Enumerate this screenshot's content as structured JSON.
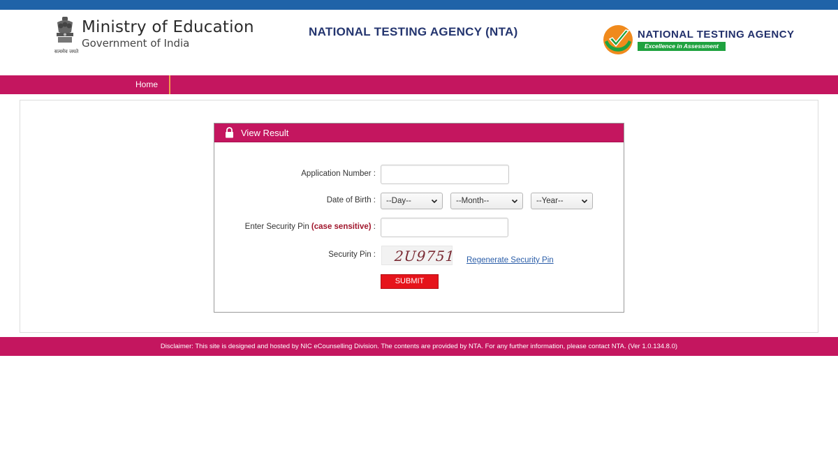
{
  "header": {
    "emblem_icon": "national-emblem-icon",
    "emblem_caption": "सत्यमेव जयते",
    "moe_title": "Ministry of Education",
    "moe_subtitle": "Government of India",
    "center_title": "NATIONAL TESTING AGENCY (NTA)",
    "nta_logo_icon": "nta-checkmark-logo-icon",
    "nta_name": "NATIONAL TESTING AGENCY",
    "nta_tagline": "Excellence in Assessment"
  },
  "nav": {
    "items": [
      {
        "label": "Home"
      }
    ]
  },
  "panel": {
    "lock_icon": "lock-icon",
    "title": "View Result"
  },
  "form": {
    "application_number_label": "Application Number :",
    "application_number_value": "",
    "dob_label": "Date of Birth :",
    "day_selected": "--Day--",
    "month_selected": "--Month--",
    "year_selected": "--Year--",
    "security_pin_label_prefix": "Enter Security Pin",
    "security_pin_label_note": "(case sensitive)",
    "security_pin_label_suffix": ":",
    "security_pin_value": "",
    "captcha_label": "Security Pin :",
    "captcha_value": "2U9751",
    "regenerate_link": "Regenerate Security Pin",
    "submit_label": "SUBMIT"
  },
  "footer": {
    "disclaimer": "Disclaimer: This site is designed and hosted by NIC eCounselling Division. The contents are provided by NTA. For any further information, please contact NTA. (Ver 1.0.134.8.0)"
  },
  "colors": {
    "top_strip": "#1f63a8",
    "brand_magenta": "#c4165f",
    "nav_separator": "#f0a04a",
    "submit_red": "#e6141b",
    "nta_green": "#1fa23f",
    "nta_orange": "#f08a1c",
    "link_blue": "#2a5da8"
  }
}
